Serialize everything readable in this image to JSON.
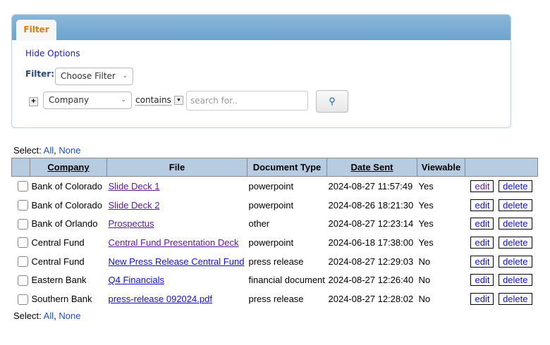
{
  "filter_panel": {
    "tab": "Filter",
    "hide_options": "Hide Options",
    "filter_label": "Filter:",
    "choose_filter": "Choose Filter",
    "field": "Company",
    "operator": "contains",
    "search_placeholder": "search for.."
  },
  "select": {
    "label": "Select:",
    "all": "All",
    "none": "None"
  },
  "table": {
    "headers": [
      "Company",
      "File",
      "Document Type",
      "Date Sent",
      "Viewable"
    ],
    "edit": "edit",
    "delete": "delete",
    "rows": [
      {
        "company": "Bank of Colorado",
        "file": "Slide Deck 1",
        "type": "powerpoint",
        "date": "2024-08-27 11:57:49",
        "viewable": "Yes"
      },
      {
        "company": "Bank of Colorado",
        "file": "Slide Deck 2",
        "type": "powerpoint",
        "date": "2024-08-26 18:21:30",
        "viewable": "Yes"
      },
      {
        "company": "Bank of Orlando",
        "file": "Prospectus",
        "type": "other",
        "date": "2024-08-27 12:23:14",
        "viewable": "Yes"
      },
      {
        "company": "Central Fund",
        "file": "Central Fund Presentation Deck",
        "type": "powerpoint",
        "date": "2024-06-18 17:38:00",
        "viewable": "Yes"
      },
      {
        "company": "Central Fund",
        "file": "New Press Release Central Fund",
        "type": "press release",
        "date": "2024-08-27 12:29:03",
        "viewable": "No"
      },
      {
        "company": "Eastern Bank",
        "file": "Q4 Financials",
        "type": "financial document",
        "date": "2024-08-27 12:26:40",
        "viewable": "No"
      },
      {
        "company": "Southern Bank",
        "file": "press-release 092024.pdf",
        "type": "press release",
        "date": "2024-08-27 12:28:02",
        "viewable": "No"
      }
    ]
  }
}
